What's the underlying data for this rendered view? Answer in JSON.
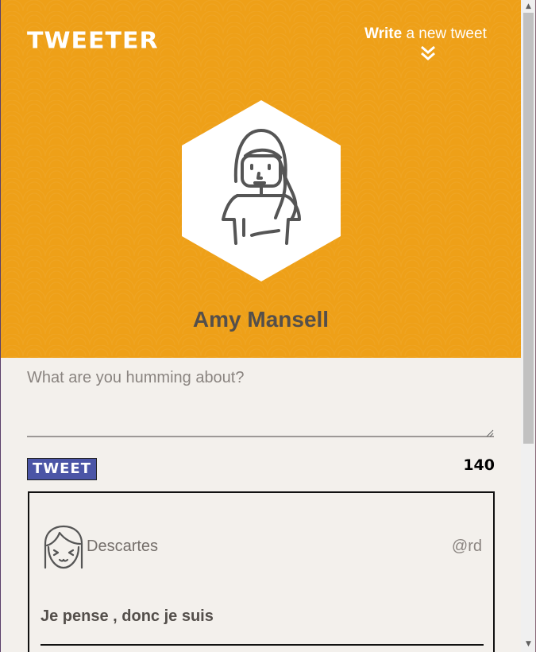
{
  "header": {
    "logo": "TWEETER",
    "write_bold": "Write",
    "write_rest": " a new tweet",
    "user_name": "Amy Mansell"
  },
  "compose": {
    "placeholder": "What are you humming about?",
    "value": ""
  },
  "actions": {
    "tweet_label": "TWEET",
    "char_count": "140"
  },
  "tweet": {
    "author_name": "Descartes",
    "handle": "@rd",
    "text": "Je pense , donc je suis"
  },
  "icons": {
    "chevron": "double-chevron-down-icon",
    "profile": "woman-avatar-icon",
    "tweet_avatar": "girl-avatar-icon"
  },
  "colors": {
    "header_bg": "#eea018",
    "tweet_button": "#4b55a6",
    "page_bg": "#f3f0ec",
    "text_dark": "#544f4b"
  }
}
